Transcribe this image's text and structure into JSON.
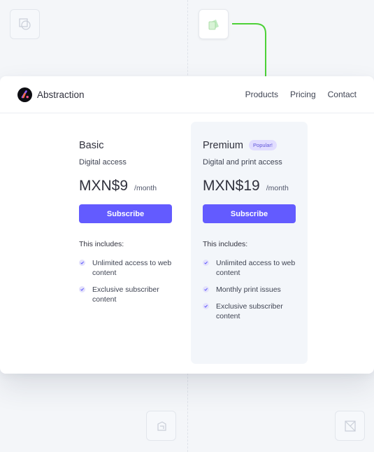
{
  "brand": {
    "name": "Abstraction"
  },
  "nav": {
    "links": [
      "Products",
      "Pricing",
      "Contact"
    ]
  },
  "plans": [
    {
      "name": "Basic",
      "badge": "",
      "subtitle": "Digital access",
      "price": "MXN$9",
      "period": "/month",
      "cta": "Subscribe",
      "includes_label": "This includes:",
      "features": [
        "Unlimited access to web content",
        "Exclusive subscriber content"
      ]
    },
    {
      "name": "Premium",
      "badge": "Popular!",
      "subtitle": "Digital and print access",
      "price": "MXN$19",
      "period": "/month",
      "cta": "Subscribe",
      "includes_label": "This includes:",
      "features": [
        "Unlimited access to web content",
        "Monthly print issues",
        "Exclusive subscriber content"
      ]
    }
  ],
  "colors": {
    "accent": "#635bff",
    "badge_bg": "#e1ddff",
    "connector": "#4cd137",
    "premium_panel": "#f3f6fa"
  },
  "icons": {
    "background_tiles": [
      "shape-icon",
      "document-icon",
      "layers-icon",
      "frame-icon"
    ],
    "check": "check-icon"
  }
}
